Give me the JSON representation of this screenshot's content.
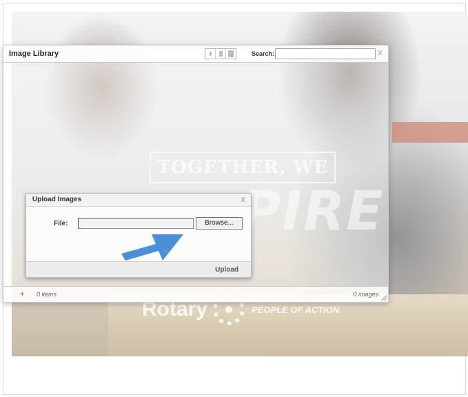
{
  "background": {
    "banner_text_1": "TOGETHER, WE",
    "banner_text_2": "PIRE",
    "brand_name": "Rotary",
    "brand_tagline": "PEOPLE OF ACTION"
  },
  "library": {
    "title": "Image Library",
    "search_label": "Search:",
    "search_value": "",
    "close_label": "X",
    "add_label": "+",
    "items_count": "0 items",
    "images_count": "0 images"
  },
  "upload": {
    "title": "Upload Images",
    "close_label": "X",
    "file_label": "File:",
    "browse_label": "Browse...",
    "upload_label": "Upload"
  },
  "colors": {
    "arrow": "#4a90d9",
    "window_border": "#c8c8c8"
  }
}
